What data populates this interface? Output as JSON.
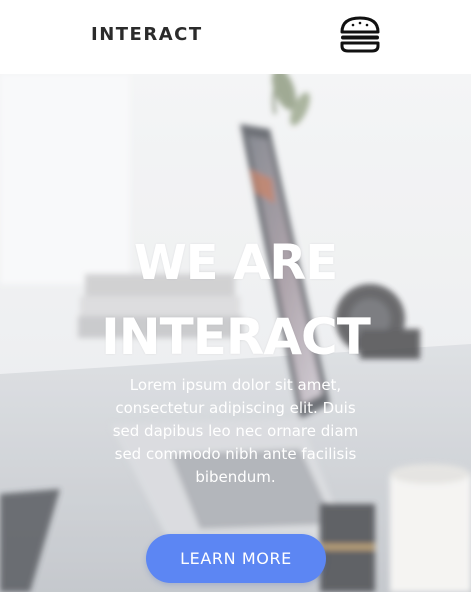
{
  "header": {
    "logo_text": "INTERACT",
    "menu_icon": "hamburger-menu-icon"
  },
  "hero": {
    "title_line1": "WE ARE",
    "title_line2": "INTERACT",
    "description": "Lorem ipsum dolor sit amet, consectetur adipiscing elit. Duis sed dapibus leo nec ornare diam sed commodo nibh ante facilisis bibendum.",
    "button_label": "LEARN MORE"
  },
  "colors": {
    "accent": "#5c86f3",
    "header_text": "#2b2b2b",
    "hero_text": "#ffffff"
  }
}
